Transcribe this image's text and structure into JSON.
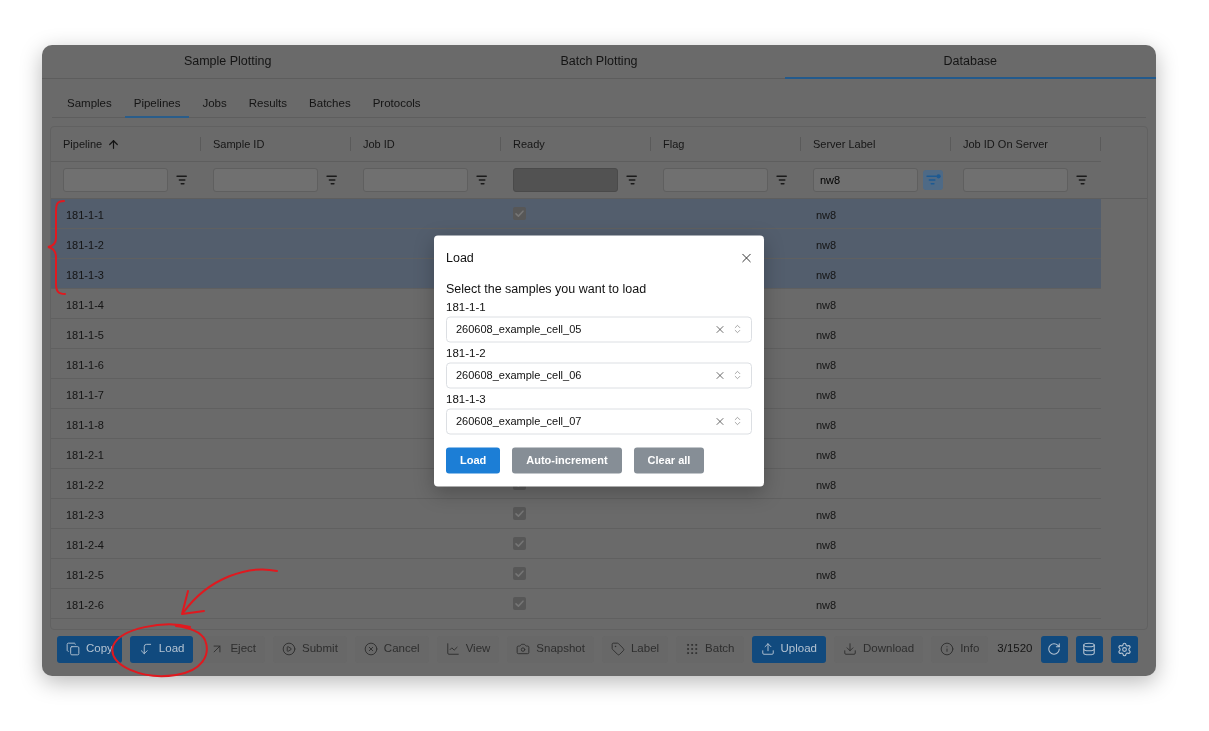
{
  "main_tabs": [
    {
      "label": "Sample Plotting",
      "selected": false
    },
    {
      "label": "Batch Plotting",
      "selected": false
    },
    {
      "label": "Database",
      "selected": true
    }
  ],
  "sub_tabs": [
    {
      "label": "Samples",
      "selected": false
    },
    {
      "label": "Pipelines",
      "selected": true
    },
    {
      "label": "Jobs",
      "selected": false
    },
    {
      "label": "Results",
      "selected": false
    },
    {
      "label": "Batches",
      "selected": false
    },
    {
      "label": "Protocols",
      "selected": false
    }
  ],
  "table": {
    "columns": [
      {
        "label": "Pipeline",
        "sorted": true,
        "filter": {
          "disabled": false,
          "active": false
        }
      },
      {
        "label": "Sample ID",
        "sorted": false,
        "filter": {
          "disabled": false,
          "active": false
        }
      },
      {
        "label": "Job ID",
        "sorted": false,
        "filter": {
          "disabled": false,
          "active": false
        }
      },
      {
        "label": "Ready",
        "sorted": false,
        "filter": {
          "disabled": true,
          "active": false
        }
      },
      {
        "label": "Flag",
        "sorted": false,
        "filter": {
          "disabled": false,
          "active": false
        }
      },
      {
        "label": "Server Label",
        "sorted": false,
        "filter": {
          "value": "nw8",
          "disabled": false,
          "active": true
        }
      },
      {
        "label": "Job ID On Server",
        "sorted": false,
        "filter": {
          "disabled": false,
          "active": false
        }
      }
    ],
    "rows": [
      {
        "pipeline": "181-1-1",
        "ready": true,
        "server_label": "nw8",
        "selected": true
      },
      {
        "pipeline": "181-1-2",
        "server_label": "nw8",
        "selected": true
      },
      {
        "pipeline": "181-1-3",
        "server_label": "nw8",
        "selected": true
      },
      {
        "pipeline": "181-1-4",
        "server_label": "nw8",
        "selected": false
      },
      {
        "pipeline": "181-1-5",
        "server_label": "nw8",
        "selected": false
      },
      {
        "pipeline": "181-1-6",
        "server_label": "nw8",
        "selected": false
      },
      {
        "pipeline": "181-1-7",
        "server_label": "nw8",
        "selected": false
      },
      {
        "pipeline": "181-1-8",
        "server_label": "nw8",
        "selected": false
      },
      {
        "pipeline": "181-2-1",
        "server_label": "nw8",
        "selected": false
      },
      {
        "pipeline": "181-2-2",
        "ready": true,
        "server_label": "nw8",
        "selected": false
      },
      {
        "pipeline": "181-2-3",
        "ready": true,
        "server_label": "nw8",
        "selected": false
      },
      {
        "pipeline": "181-2-4",
        "ready": true,
        "server_label": "nw8",
        "selected": false
      },
      {
        "pipeline": "181-2-5",
        "ready": true,
        "server_label": "nw8",
        "selected": false
      },
      {
        "pipeline": "181-2-6",
        "ready": true,
        "server_label": "nw8",
        "selected": false
      }
    ]
  },
  "toolbar": {
    "buttons": [
      {
        "label": "Copy",
        "disabled": false
      },
      {
        "label": "Load",
        "disabled": false
      },
      {
        "label": "Eject",
        "disabled": true
      },
      {
        "label": "Submit",
        "disabled": true
      },
      {
        "label": "Cancel",
        "disabled": true
      },
      {
        "label": "View",
        "disabled": true
      },
      {
        "label": "Snapshot",
        "disabled": true
      },
      {
        "label": "Label",
        "disabled": true
      },
      {
        "label": "Batch",
        "disabled": true
      },
      {
        "label": "Upload",
        "disabled": false
      },
      {
        "label": "Download",
        "disabled": true
      },
      {
        "label": "Info",
        "disabled": true
      }
    ],
    "count": "3/1520"
  },
  "dialog": {
    "title": "Load",
    "prompt": "Select the samples you want to load",
    "fields": [
      {
        "label": "181-1-1",
        "value": "260608_example_cell_05"
      },
      {
        "label": "181-1-2",
        "value": "260608_example_cell_06"
      },
      {
        "label": "181-1-3",
        "value": "260608_example_cell_07"
      }
    ],
    "buttons": [
      {
        "label": "Load",
        "kind": "primary"
      },
      {
        "label": "Auto-increment",
        "kind": "secondary"
      },
      {
        "label": "Clear all",
        "kind": "secondary"
      }
    ]
  }
}
